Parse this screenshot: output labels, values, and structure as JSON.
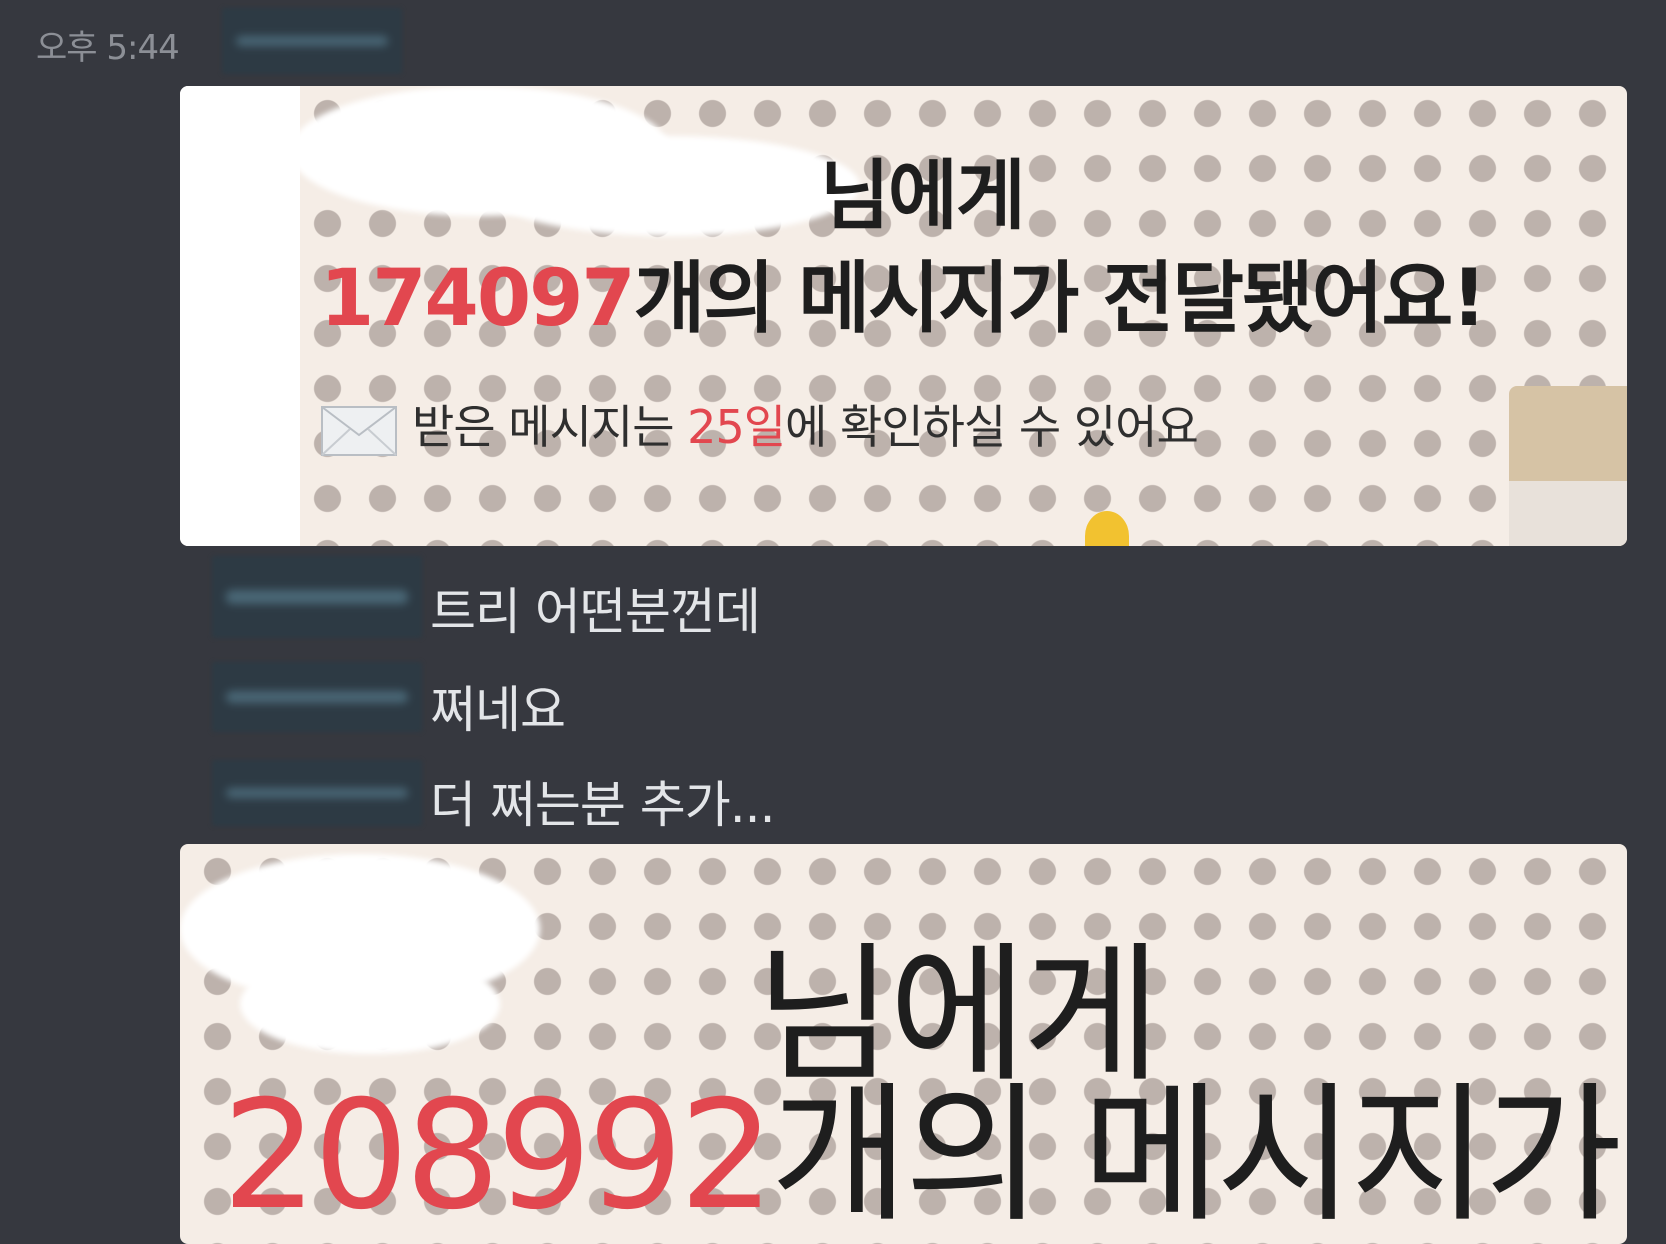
{
  "header": {
    "timestamp": "오후 5:44"
  },
  "card1": {
    "name_suffix": "님에게",
    "count": "174097",
    "delivered_text": "개의 메시지가 전달됐어요!",
    "sub_prefix": "받은 메시지는",
    "sub_date": "25일",
    "sub_suffix": "에 확인하실 수 있어요",
    "envelope_icon": "envelope-icon",
    "accent_color": "#e2474f"
  },
  "messages": [
    {
      "text": "트리 어떤분껀데"
    },
    {
      "text": "쩌네요"
    },
    {
      "text": "더 쩌는분 추가..."
    }
  ],
  "card2": {
    "name_suffix": "님에게",
    "count": "208992",
    "delivered_text": "개의 메시지가"
  }
}
